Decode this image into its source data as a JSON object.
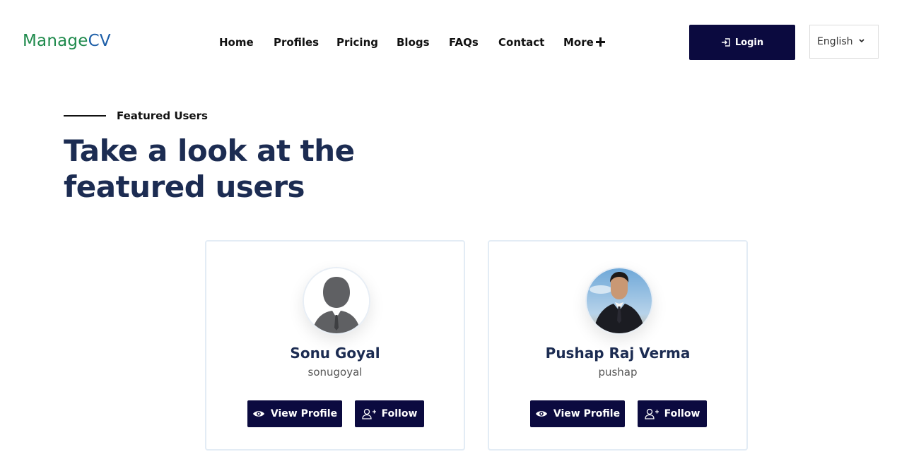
{
  "header": {
    "logo_part1": "Manage",
    "logo_part2": "CV",
    "nav": [
      {
        "label": "Home"
      },
      {
        "label": "Profiles"
      },
      {
        "label": "Pricing"
      },
      {
        "label": "Blogs"
      },
      {
        "label": "FAQs"
      },
      {
        "label": "Contact"
      },
      {
        "label": "More"
      }
    ],
    "login_label": "Login",
    "language": "English"
  },
  "section": {
    "eyebrow": "Featured Users",
    "headline": "Take a look at the featured users"
  },
  "users": [
    {
      "name": "Sonu Goyal",
      "handle": "sonugoyal",
      "view_label": "View Profile",
      "follow_label": "Follow"
    },
    {
      "name": "Pushap Raj Verma",
      "handle": "pushap",
      "view_label": "View Profile",
      "follow_label": "Follow"
    }
  ],
  "colors": {
    "brand_green": "#1f8a4c",
    "brand_blue": "#1e5fa8",
    "button_navy": "#0b0a3f",
    "heading_navy": "#1c2c52"
  }
}
